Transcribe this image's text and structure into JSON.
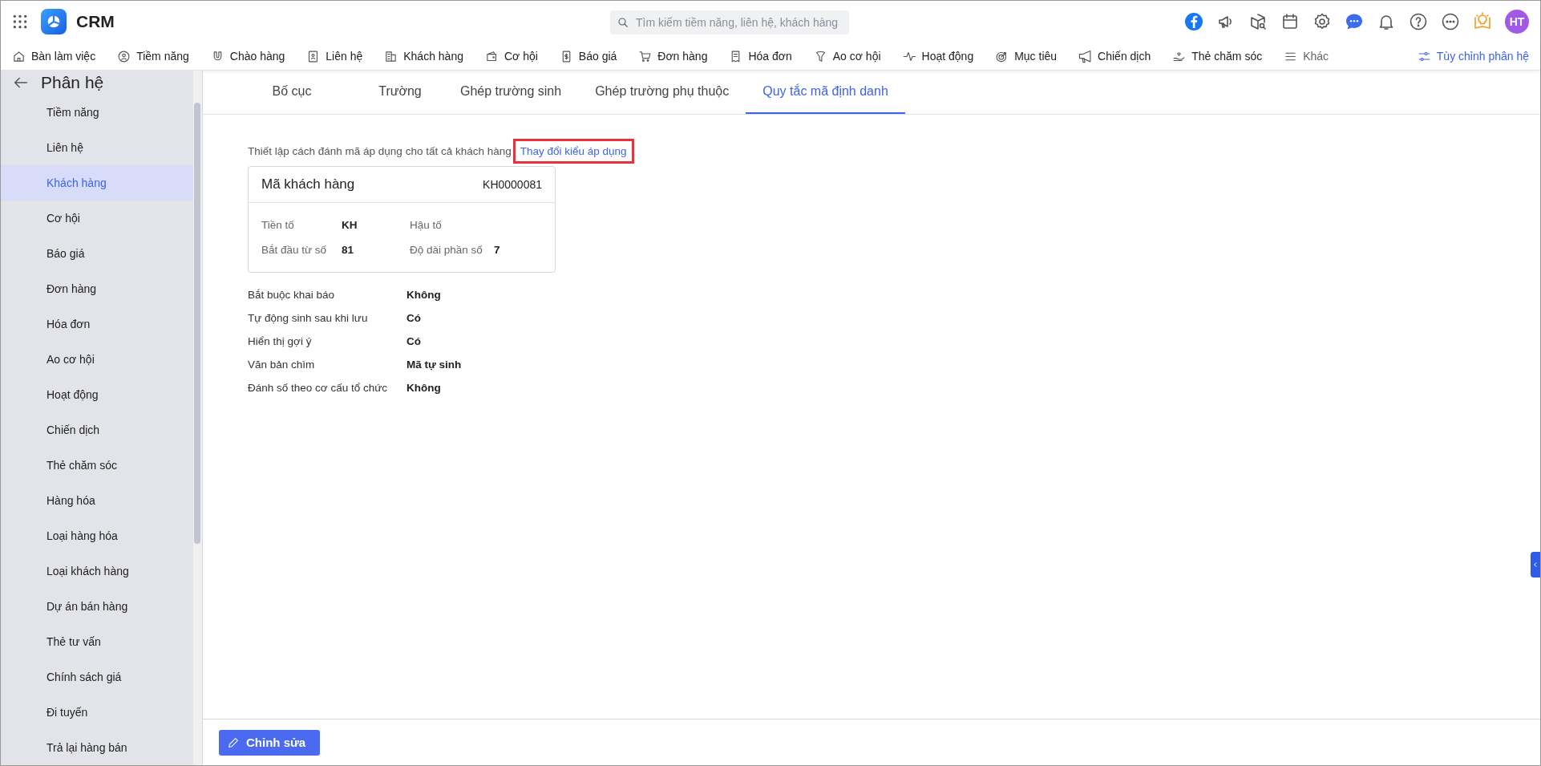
{
  "app": {
    "name": "CRM"
  },
  "search": {
    "placeholder": "Tìm kiếm tiềm năng, liên hệ, khách hàng"
  },
  "user": {
    "initials": "HT"
  },
  "nav": {
    "items": [
      {
        "label": "Bàn làm việc"
      },
      {
        "label": "Tiềm năng"
      },
      {
        "label": "Chào hàng"
      },
      {
        "label": "Liên hệ"
      },
      {
        "label": "Khách hàng"
      },
      {
        "label": "Cơ hội"
      },
      {
        "label": "Báo giá"
      },
      {
        "label": "Đơn hàng"
      },
      {
        "label": "Hóa đơn"
      },
      {
        "label": "Ao cơ hội"
      },
      {
        "label": "Hoạt động"
      },
      {
        "label": "Mục tiêu"
      },
      {
        "label": "Chiến dịch"
      },
      {
        "label": "Thẻ chăm sóc"
      }
    ],
    "more": "Khác",
    "customize": "Tùy chỉnh phân hệ"
  },
  "sidebar": {
    "title": "Phân hệ",
    "items": [
      {
        "label": "Tiềm năng",
        "selected": false
      },
      {
        "label": "Liên hệ",
        "selected": false
      },
      {
        "label": "Khách hàng",
        "selected": true
      },
      {
        "label": "Cơ hội",
        "selected": false
      },
      {
        "label": "Báo giá",
        "selected": false
      },
      {
        "label": "Đơn hàng",
        "selected": false
      },
      {
        "label": "Hóa đơn",
        "selected": false
      },
      {
        "label": "Ao cơ hội",
        "selected": false
      },
      {
        "label": "Hoạt động",
        "selected": false
      },
      {
        "label": "Chiến dịch",
        "selected": false
      },
      {
        "label": "Thẻ chăm sóc",
        "selected": false
      },
      {
        "label": "Hàng hóa",
        "selected": false
      },
      {
        "label": "Loại hàng hóa",
        "selected": false
      },
      {
        "label": "Loại khách hàng",
        "selected": false
      },
      {
        "label": "Dự án bán hàng",
        "selected": false
      },
      {
        "label": "Thẻ tư vấn",
        "selected": false
      },
      {
        "label": "Chính sách giá",
        "selected": false
      },
      {
        "label": "Đi tuyến",
        "selected": false
      },
      {
        "label": "Trả lại hàng bán",
        "selected": false
      }
    ]
  },
  "tabs": [
    {
      "label": "Bố cục",
      "selected": false
    },
    {
      "label": "Trường",
      "selected": false
    },
    {
      "label": "Ghép trường sinh",
      "selected": false
    },
    {
      "label": "Ghép trường phụ thuộc",
      "selected": false
    },
    {
      "label": "Quy tắc mã định danh",
      "selected": true
    }
  ],
  "description": {
    "text": "Thiết lập cách đánh mã áp dụng cho tất cả khách hàng",
    "link": "Thay đổi kiểu áp dụng",
    "link_highlighted": true
  },
  "code_card": {
    "title": "Mã khách hàng",
    "sample": "KH0000081",
    "fields": [
      {
        "label": "Tiền tố",
        "value": "KH"
      },
      {
        "label": "Hậu tố"
      },
      {
        "label": "Bắt đầu từ số",
        "value": "81"
      },
      {
        "label": "Độ dài phần số",
        "value": "7"
      }
    ]
  },
  "settings": [
    {
      "label": "Bắt buộc khai báo",
      "value": "Không"
    },
    {
      "label": "Tự động sinh sau khi lưu",
      "value": "Có"
    },
    {
      "label": "Hiển thị gợi ý",
      "value": "Có"
    },
    {
      "label": "Văn bản chìm",
      "value": "Mã tự sinh"
    },
    {
      "label": "Đánh số theo cơ cấu tổ chức",
      "value": "Không"
    }
  ],
  "footer": {
    "edit_button": "Chỉnh sửa"
  }
}
